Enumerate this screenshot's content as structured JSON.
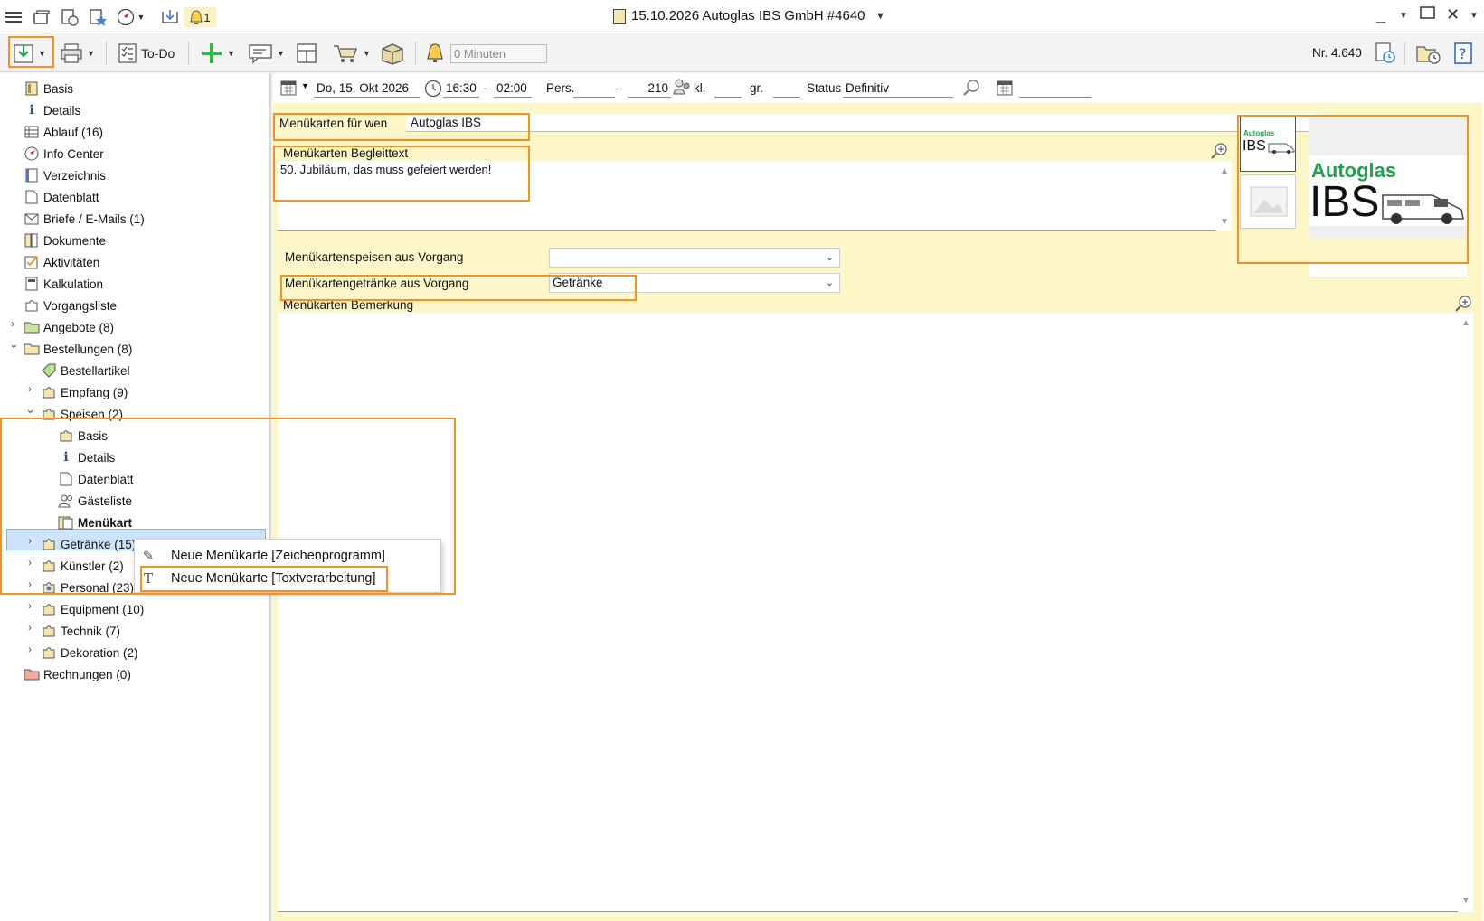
{
  "window": {
    "title": "15.10.2026 Autoglas IBS GmbH  #4640",
    "notification_count": "1"
  },
  "toolbar": {
    "todo_label": "To-Do",
    "minutes_placeholder": "0 Minuten",
    "number_label": "Nr. 4.640"
  },
  "sidebar": {
    "items": {
      "basis": "Basis",
      "details": "Details",
      "ablauf": "Ablauf (16)",
      "info_center": "Info Center",
      "verzeichnis": "Verzeichnis",
      "datenblatt": "Datenblatt",
      "briefe": "Briefe / E-Mails (1)",
      "dokumente": "Dokumente",
      "aktivitaeten": "Aktivitäten",
      "kalkulation": "Kalkulation",
      "vorgangsliste": "Vorgangsliste",
      "angebote": "Angebote (8)",
      "bestellungen": "Bestellungen (8)",
      "bestellartikel": "Bestellartikel",
      "empfang": "Empfang (9)",
      "speisen": "Speisen (2)",
      "speisen_basis": "Basis",
      "speisen_details": "Details",
      "speisen_datenblatt": "Datenblatt",
      "gaesteliste": "Gästeliste",
      "menuekarten": "Menükart",
      "getraenke": "Getränke (15)",
      "kuenstler": "Künstler (2)",
      "personal": "Personal (23)",
      "equipment": "Equipment (10)",
      "technik": "Technik (7)",
      "dekoration": "Dekoration (2)",
      "rechnungen": "Rechnungen (0)"
    }
  },
  "context_menu": {
    "items": [
      {
        "label": "Neue Menükarte [Zeichenprogramm]",
        "icon": "pen-icon"
      },
      {
        "label": "Neue Menükarte [Textverarbeitung]",
        "icon": "text-icon"
      }
    ]
  },
  "datebar": {
    "date": "Do, 15. Okt 2026",
    "time_from": "16:30",
    "time_sep": "-",
    "time_to": "02:00",
    "pers_label": "Pers.",
    "pers_sep": "-",
    "pers_value": "210",
    "kl_label": "kl.",
    "gr_label": "gr.",
    "status_label": "Status",
    "status_value": "Definitiv"
  },
  "form": {
    "fuer_wen_label": "Menükarten für wen",
    "fuer_wen_value": "Autoglas IBS",
    "begleittext_label": "Menükarten Begleittext",
    "begleittext_value": "50. Jubiläum, das muss gefeiert werden!",
    "speisen_label": "Menükartenspeisen aus Vorgang",
    "speisen_value": "",
    "getraenke_label": "Menükartengetränke aus Vorgang",
    "getraenke_value": "Getränke",
    "bemerkung_label": "Menükarten Bemerkung"
  },
  "logo": {
    "small_top": "Autoglas",
    "small_bottom": "IBS",
    "large_top": "Autoglas",
    "large_bottom": "IBS"
  },
  "colors": {
    "highlight": "#f39221",
    "yellow_bg": "#fdf6c8",
    "logo_green": "#1aa54a",
    "selection": "#cfe4fa"
  }
}
